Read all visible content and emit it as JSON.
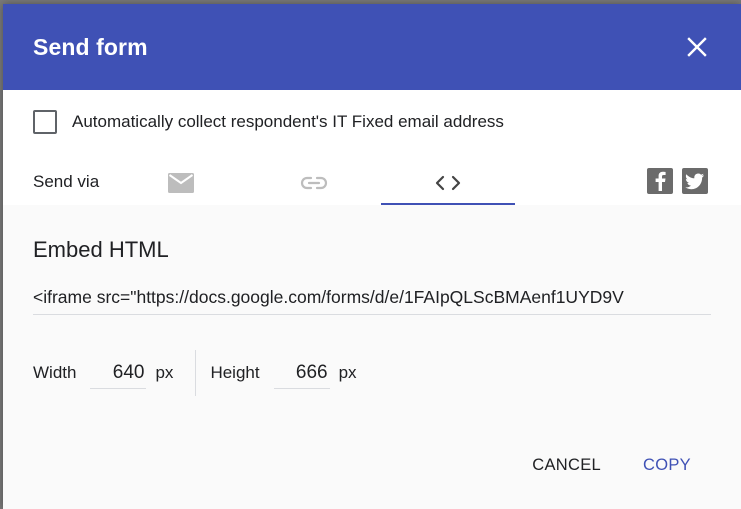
{
  "dialog": {
    "title": "Send form",
    "collect_email_label": "Automatically collect respondent's IT Fixed email address",
    "collect_email_checked": false,
    "send_via_label": "Send via",
    "tabs": [
      {
        "icon": "email-icon",
        "active": false
      },
      {
        "icon": "link-icon",
        "active": false
      },
      {
        "icon": "embed-code-icon",
        "active": true
      }
    ],
    "social": [
      {
        "icon": "facebook-icon"
      },
      {
        "icon": "twitter-icon"
      }
    ],
    "embed": {
      "title": "Embed HTML",
      "code": "<iframe src=\"https://docs.google.com/forms/d/e/1FAIpQLScBMAenf1UYD9V",
      "width_label": "Width",
      "width_value": "640",
      "height_label": "Height",
      "height_value": "666",
      "unit": "px"
    },
    "actions": {
      "cancel_label": "CANCEL",
      "copy_label": "COPY"
    }
  },
  "colors": {
    "header": "#3f51b5",
    "accent": "#3f51b5"
  }
}
